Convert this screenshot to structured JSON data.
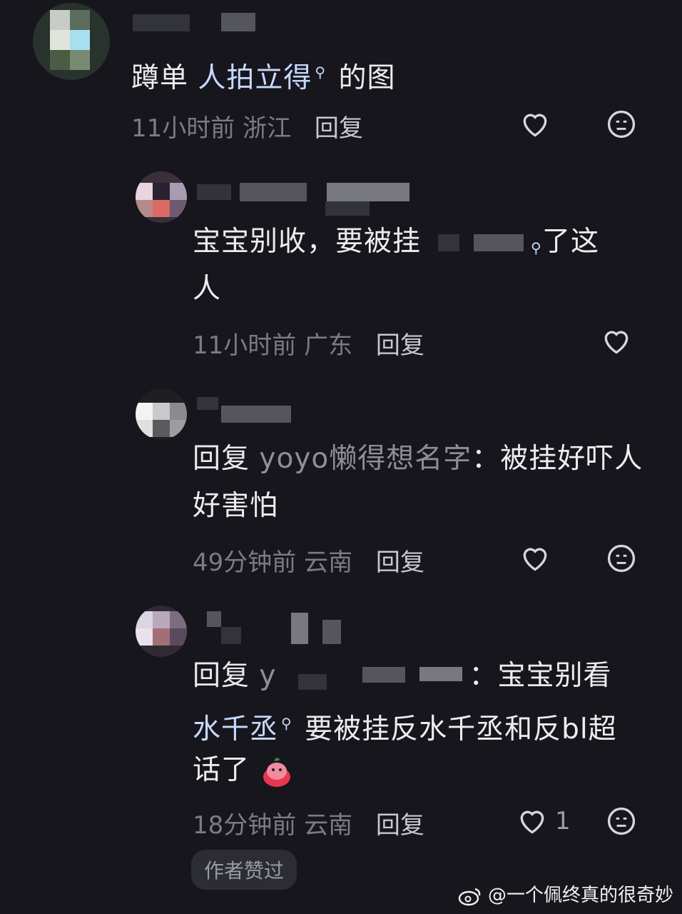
{
  "comments": [
    {
      "text_part1": "蹲单 ",
      "link": "人拍立得",
      "text_part2": " 的图",
      "time": "11小时前",
      "location": "浙江",
      "reply_label": "回复"
    },
    {
      "line1_a": "宝宝别收，要被挂",
      "line1_b": "了这",
      "line2": "人",
      "time": "11小时前",
      "location": "广东",
      "reply_label": "回复"
    },
    {
      "prefix": "回复 ",
      "target": "yoyo懒得想名字",
      "colon_text": "：被挂好吓人",
      "line2": "好害怕",
      "time": "49分钟前",
      "location": "云南",
      "reply_label": "回复"
    },
    {
      "prefix": "回复 ",
      "target_start": "y",
      "colon_text": "：宝宝别看",
      "line2_link": "水千丞",
      "line2_text": " 要被挂反水千丞和反bl超",
      "line3": "话了",
      "time": "18分钟前",
      "location": "云南",
      "reply_label": "回复",
      "like_count": "1",
      "author_badge": "作者赞过"
    }
  ],
  "icons": {
    "heart": "heart-icon",
    "emoji": "neutral-face-icon",
    "search": "search-icon",
    "weibo": "weibo-icon"
  },
  "watermark": "@一个佩终真的很奇妙"
}
